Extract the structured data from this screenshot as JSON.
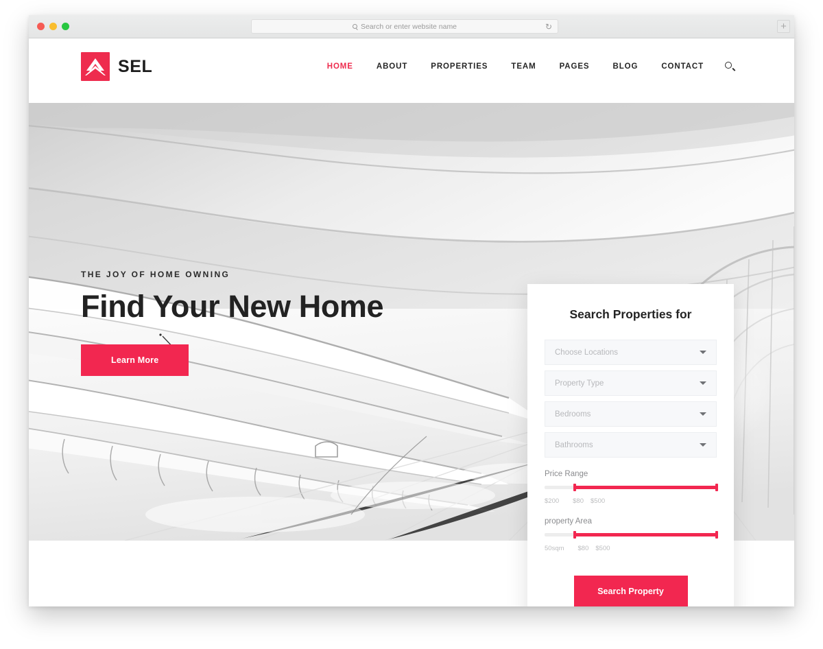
{
  "browser": {
    "traffic_lights": [
      "close",
      "minimize",
      "zoom"
    ],
    "url_bar": {
      "placeholder": "Search or enter website name",
      "value": "",
      "search_icon": "search-icon",
      "reload_icon": "reload-icon",
      "reload_glyph": "↻"
    },
    "new_tab_label": "+"
  },
  "header": {
    "logo": {
      "text": "SEL",
      "mark": "mountain-roof-logo-icon",
      "color": "#ee2c4e"
    },
    "nav": [
      {
        "label": "HOME",
        "active": true
      },
      {
        "label": "ABOUT",
        "active": false
      },
      {
        "label": "PROPERTIES",
        "active": false
      },
      {
        "label": "TEAM",
        "active": false
      },
      {
        "label": "PAGES",
        "active": false
      },
      {
        "label": "BLOG",
        "active": false
      },
      {
        "label": "CONTACT",
        "active": false
      }
    ],
    "search_icon": "search-icon"
  },
  "hero": {
    "eyebrow": "THE JOY OF HOME OWNING",
    "title": "Find Your New Home",
    "cta_label": "Learn More",
    "image_alt": "white-architectural-corridor"
  },
  "search_panel": {
    "title": "Search Properties for",
    "selects": [
      {
        "placeholder": "Choose Locations",
        "value": ""
      },
      {
        "placeholder": "Property Type",
        "value": ""
      },
      {
        "placeholder": "Bedrooms",
        "value": ""
      },
      {
        "placeholder": "Bathrooms",
        "value": ""
      }
    ],
    "sliders": [
      {
        "label": "Price Range",
        "values": [
          "$200",
          "$80",
          "$500"
        ],
        "fill_start_pct": 17.5,
        "fill_end_pct": 100
      },
      {
        "label": "property Area",
        "values": [
          "50sqm",
          "$80",
          "$500"
        ],
        "fill_start_pct": 17.5,
        "fill_end_pct": 100
      }
    ],
    "submit_label": "Search Property"
  },
  "colors": {
    "accent": "#f22750",
    "logo": "#ee2c4e",
    "heading": "#222222",
    "muted": "#b7b8bb"
  }
}
